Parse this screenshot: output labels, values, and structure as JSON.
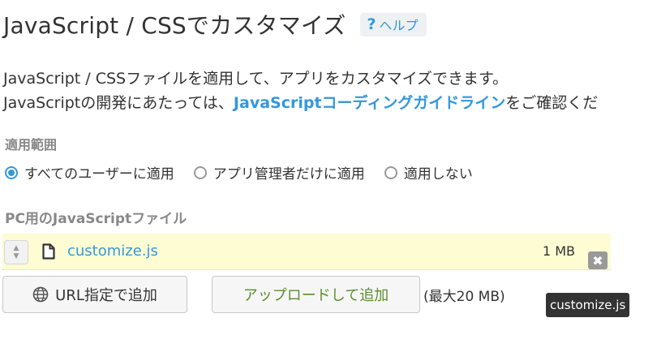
{
  "header": {
    "title": "JavaScript / CSSでカスタマイズ",
    "help_icon": "?",
    "help_label": "ヘルプ"
  },
  "description": {
    "line1": "JavaScript / CSSファイルを適用して、アプリをカスタマイズできます。",
    "line2_prefix": "JavaScriptの開発にあたっては、",
    "line2_link": "JavaScriptコーディングガイドライン",
    "line2_suffix": "をご確認くだ"
  },
  "scope": {
    "label": "適用範囲",
    "options": [
      {
        "label": "すべてのユーザーに適用",
        "checked": true
      },
      {
        "label": "アプリ管理者だけに適用",
        "checked": false
      },
      {
        "label": "適用しない",
        "checked": false
      }
    ]
  },
  "pc_js": {
    "label": "PC用のJavaScriptファイル",
    "files": [
      {
        "name": "customize.js",
        "size": "1 MB"
      }
    ]
  },
  "buttons": {
    "url_add": "URL指定で追加",
    "upload_add": "アップロードして追加",
    "max_note": "(最大20 MB)"
  },
  "tooltip": {
    "text": "customize.js"
  },
  "icons": {
    "drag_up": "▲",
    "drag_down": "▼",
    "remove": "✖"
  },
  "colors": {
    "accent": "#3498db",
    "upload_text": "#5b8f2c",
    "file_row_bg": "#fdfcd3"
  }
}
